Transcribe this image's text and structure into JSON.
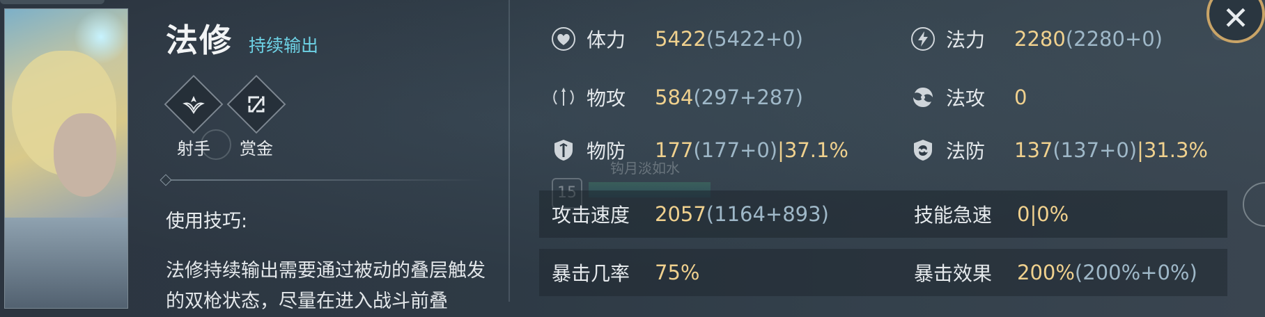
{
  "hero": {
    "name": "法修",
    "tag": "持续输出",
    "roles": [
      {
        "label": "射手",
        "icon": "marksman-icon"
      },
      {
        "label": "赏金",
        "icon": "bounty-icon"
      }
    ]
  },
  "tips": {
    "title": "使用技巧:",
    "text": "法修持续输出需要通过被动的叠层触发的双枪状态，尽量在进入战斗前叠"
  },
  "ghost": {
    "name": "钩月淡如水",
    "level": "15"
  },
  "stats": {
    "hp": {
      "label": "体力",
      "main": "5422",
      "breakdown": "(5422+0)"
    },
    "mana": {
      "label": "法力",
      "main": "2280",
      "breakdown": "(2280+0)"
    },
    "patk": {
      "label": "物攻",
      "main": "584",
      "breakdown": "(297+287)"
    },
    "matk": {
      "label": "法攻",
      "main": "0",
      "breakdown": ""
    },
    "pdef": {
      "label": "物防",
      "main": "177",
      "breakdown": "(177+0)",
      "extra": "|37.1%"
    },
    "mdef": {
      "label": "法防",
      "main": "137",
      "breakdown": "(137+0)",
      "extra": "|31.3%"
    },
    "aspd": {
      "label": "攻击速度",
      "main": "2057",
      "breakdown": "(1164+893)"
    },
    "haste": {
      "label": "技能急速",
      "main": "0|0%",
      "breakdown": ""
    },
    "crit": {
      "label": "暴击几率",
      "main": "75%",
      "breakdown": ""
    },
    "critdmg": {
      "label": "暴击效果",
      "main": "200%",
      "breakdown": "(200%+0%)"
    }
  },
  "colors": {
    "value": "#f0d18e",
    "breakdown": "#9fb8c8",
    "accent": "#6ed3e6",
    "frame": "#c9a467"
  }
}
